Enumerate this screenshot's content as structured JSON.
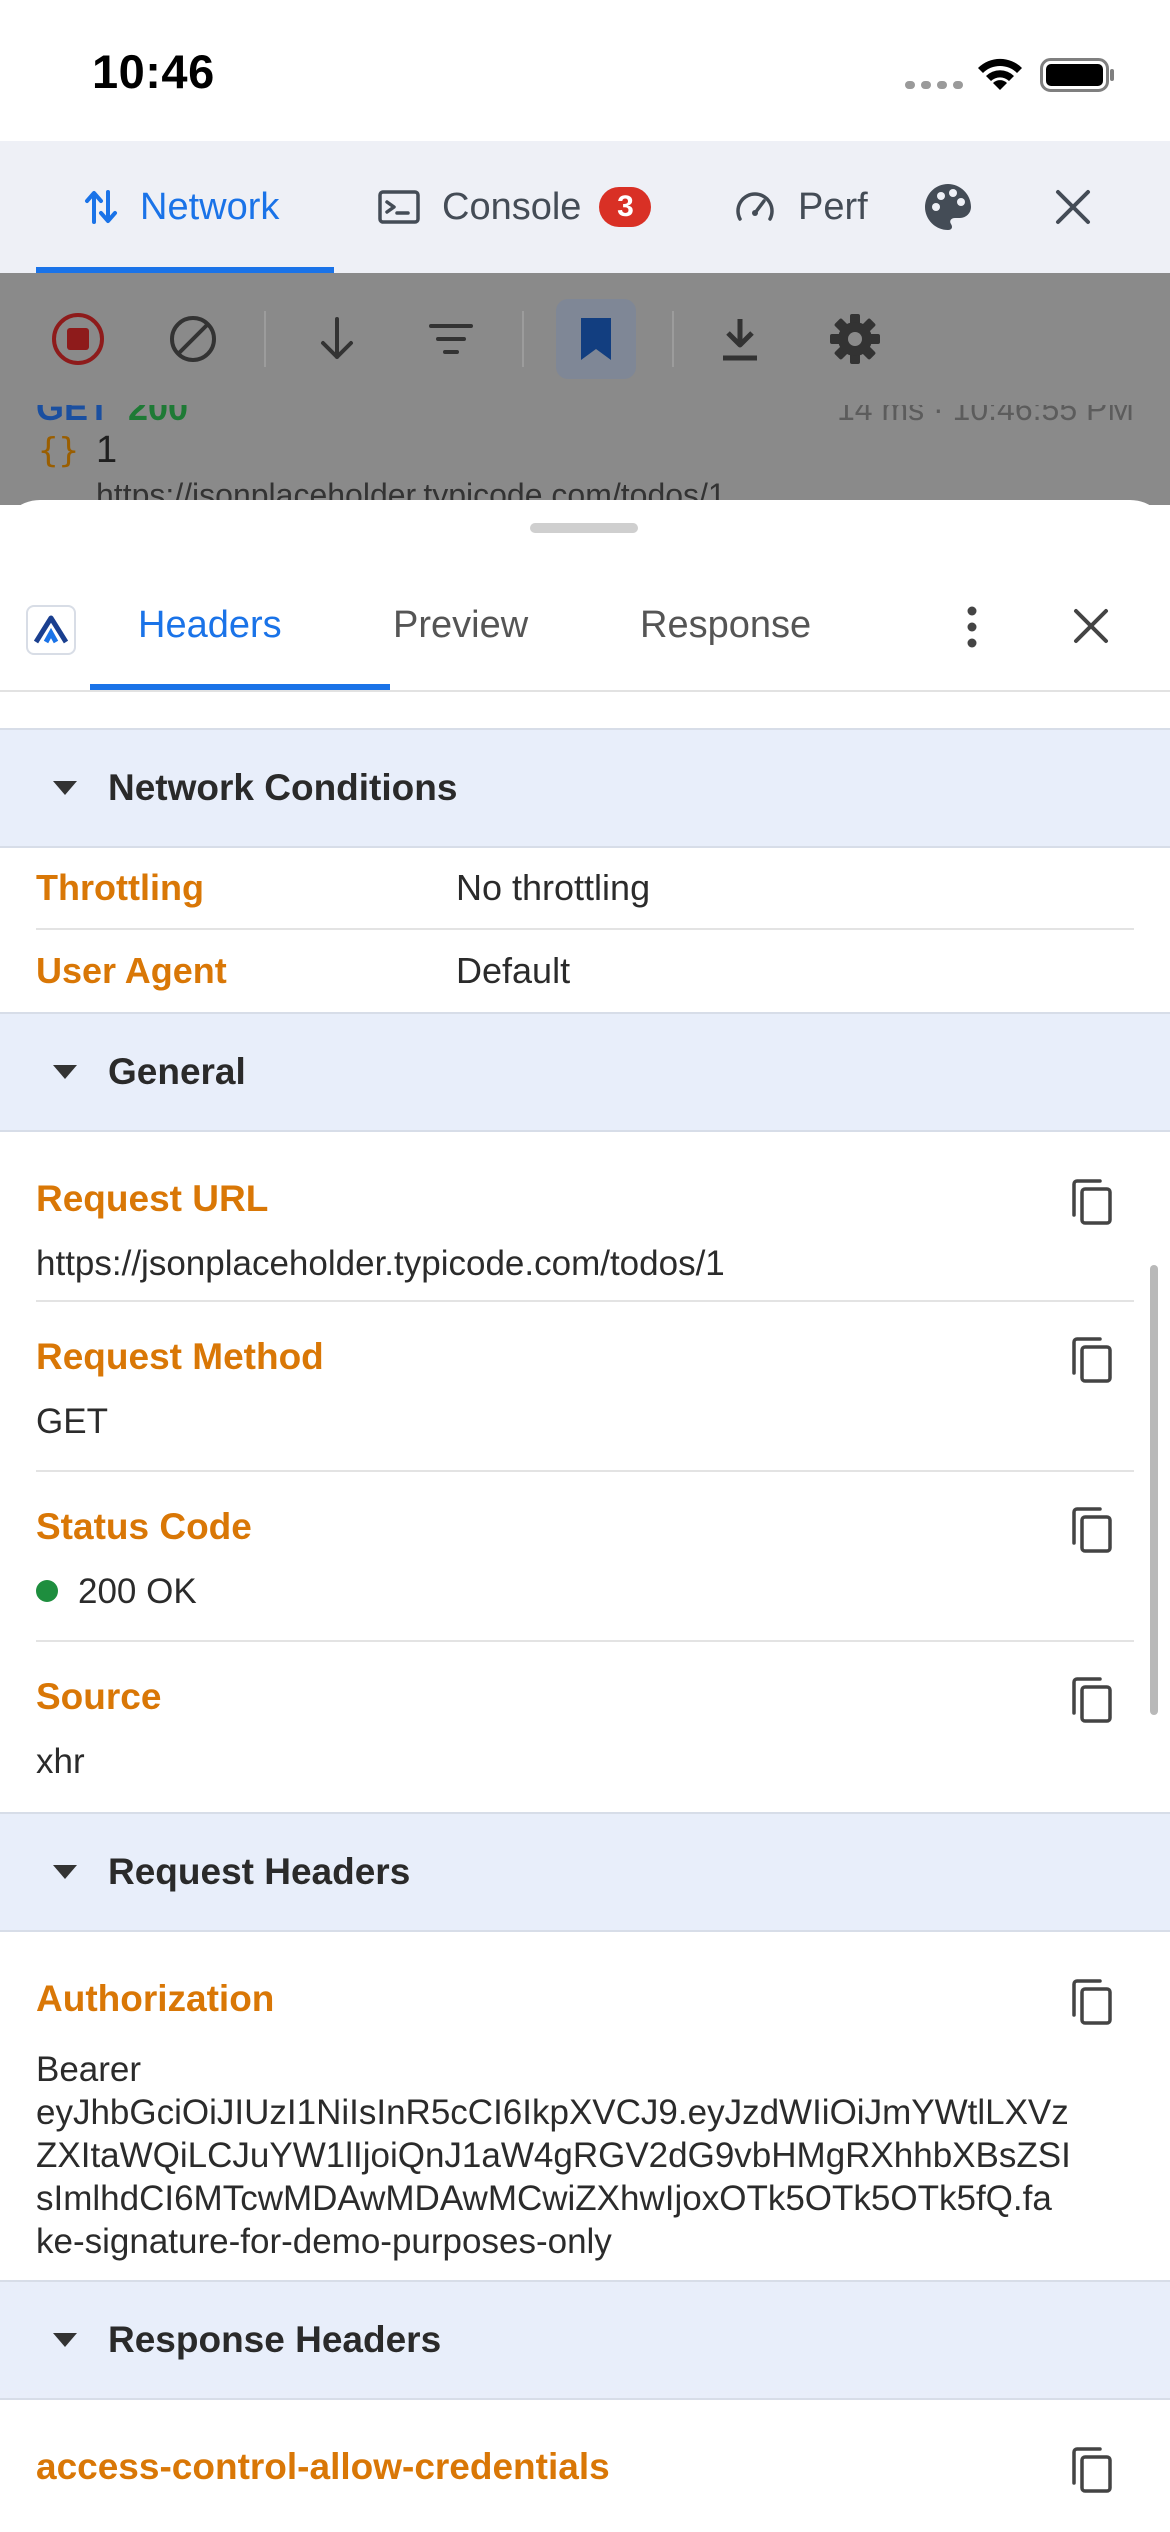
{
  "status_bar": {
    "time": "10:46"
  },
  "devtools_tabs": [
    {
      "label": "Network",
      "icon": "up-down-arrows-icon",
      "active": true
    },
    {
      "label": "Console",
      "icon": "terminal-icon",
      "badge": "3"
    },
    {
      "label": "Perf",
      "icon": "speedometer-icon"
    }
  ],
  "toolbar": {
    "icons": [
      "record-stop-icon",
      "clear-icon",
      "sort-down-icon",
      "filter-icon",
      "bookmark-icon",
      "download-icon",
      "settings-icon"
    ]
  },
  "request_list": {
    "row": {
      "method": "GET",
      "status": "200",
      "meta": "14 ms · 10:46:55 PM",
      "name": "1",
      "url": "https://jsonplaceholder.typicode.com/todos/1"
    }
  },
  "sheet": {
    "tabs": [
      "Headers",
      "Preview",
      "Response"
    ],
    "active_tab": "Headers"
  },
  "network_conditions": {
    "title": "Network Conditions",
    "rows": [
      {
        "key": "Throttling",
        "value": "No throttling"
      },
      {
        "key": "User Agent",
        "value": "Default"
      }
    ]
  },
  "general": {
    "title": "General",
    "items": [
      {
        "key": "Request URL",
        "value": "https://jsonplaceholder.typicode.com/todos/1"
      },
      {
        "key": "Request Method",
        "value": "GET"
      },
      {
        "key": "Status Code",
        "value": "200 OK"
      },
      {
        "key": "Source",
        "value": "xhr"
      }
    ]
  },
  "request_headers": {
    "title": "Request Headers",
    "items": [
      {
        "key": "Authorization",
        "lines": [
          "Bearer",
          "eyJhbGciOiJIUzI1NiIsInR5cCI6IkpXVCJ9.eyJzdWIiOiJmYWtlLXVz",
          "ZXItaWQiLCJuYW1lIjoiQnJ1aW4gRGV2dG9vbHMgRXhhbXBsZSI",
          "sImlhdCI6MTcwMDAwMDAwMCwiZXhwIjoxOTk5OTk5OTk5fQ.fa",
          "ke-signature-for-demo-purposes-only"
        ]
      }
    ]
  },
  "response_headers": {
    "title": "Response Headers",
    "items": [
      {
        "key": "access-control-allow-credentials"
      }
    ]
  },
  "colors": {
    "accent": "#1a73e8",
    "key_orange": "#d97706",
    "section_bg": "#e8eefa",
    "status_ok": "#1e8e3e",
    "badge_red": "#d93025"
  }
}
